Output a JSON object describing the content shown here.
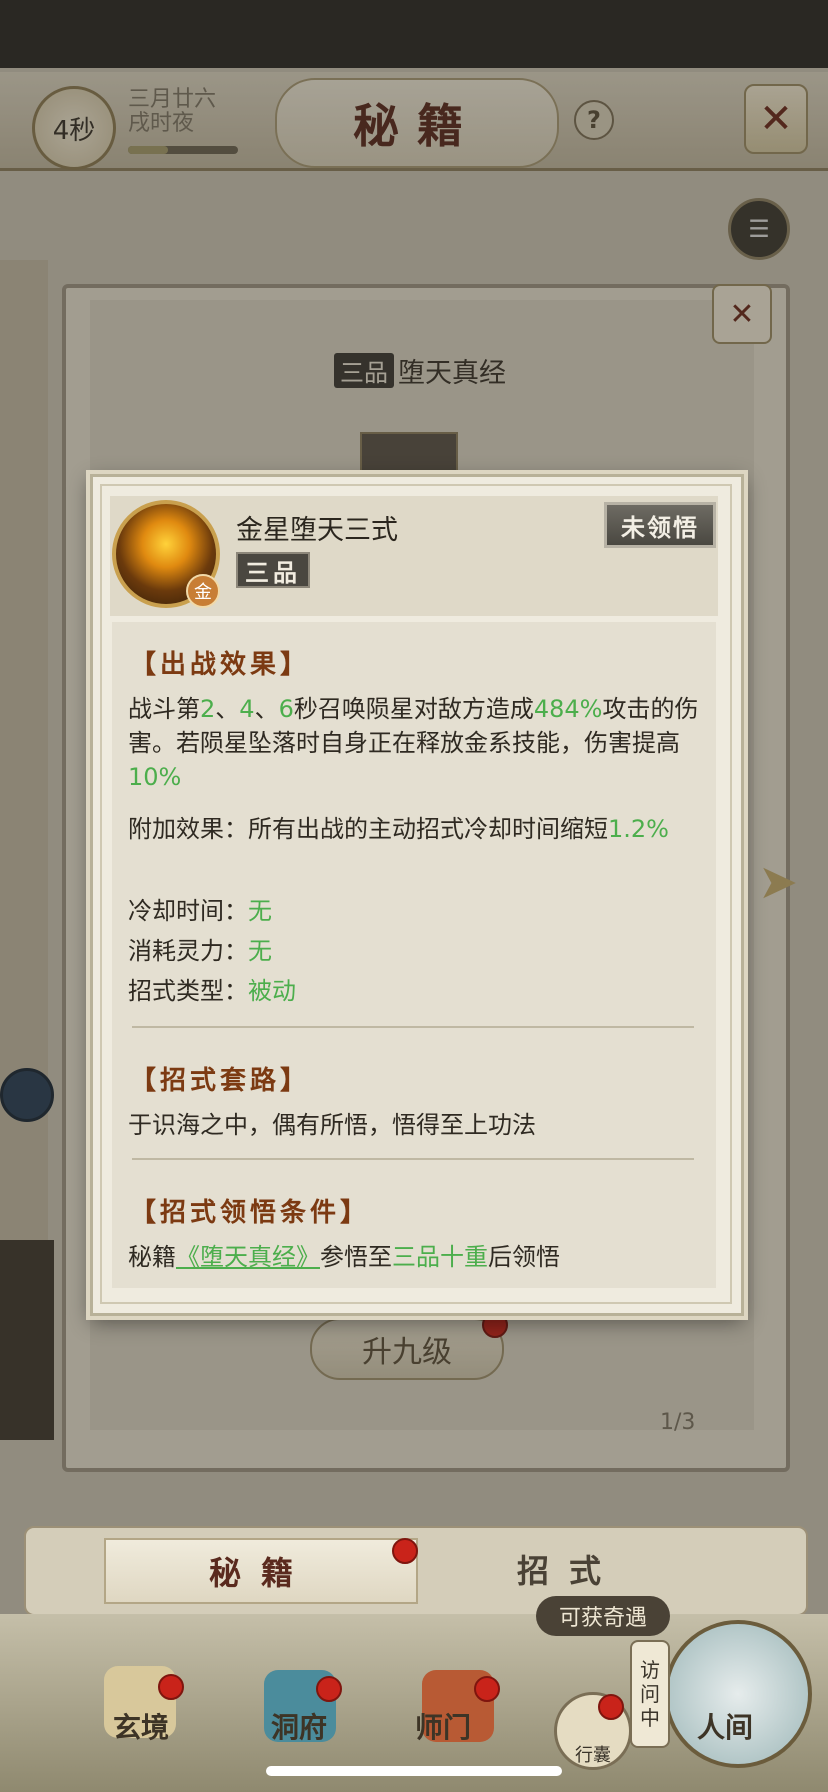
{
  "header": {
    "timer": "4秒",
    "date_line1": "三月廿六",
    "date_line2": "戌时夜",
    "title": "秘籍",
    "help": "?"
  },
  "book": {
    "grade": "三品",
    "name": "堕天真经",
    "upgrade_button": "升九级",
    "page_indicator": "1/3"
  },
  "dialog": {
    "skill_name": "金星堕天三式",
    "grade": "三品",
    "element_badge": "金",
    "status": "未领悟",
    "sections": {
      "effect_title": "【出战效果】",
      "effect_parts": [
        "战斗第",
        "2",
        "、",
        "4",
        "、",
        "6",
        "秒召唤陨星对敌方造成",
        "484%",
        "攻击的伤害。若陨星坠落时自身正在释放金系技能，伤害提高",
        "10%"
      ],
      "extra_prefix": "附加效果：所有出战的主动招式冷却时间缩短",
      "extra_value": "1.2%",
      "cooldown_label": "冷却时间：",
      "cooldown_value": "无",
      "cost_label": "消耗灵力：",
      "cost_value": "无",
      "type_label": "招式类型：",
      "type_value": "被动",
      "routine_title": "【招式套路】",
      "routine_text": "于识海之中，偶有所悟，悟得至上功法",
      "condition_title": "【招式领悟条件】",
      "condition_prefix": "秘籍",
      "condition_book": "《堕天真经》",
      "condition_mid": "参悟至",
      "condition_level": "三品十重",
      "condition_suffix": "后领悟"
    }
  },
  "tabs": [
    "秘籍",
    "招式"
  ],
  "bottom_nav": {
    "chance_tag": "可获奇遇",
    "visit_tag": [
      "访",
      "问",
      "中"
    ],
    "bag": "行囊",
    "items": [
      "玄境",
      "洞府",
      "师门",
      "人间"
    ]
  },
  "colors": {
    "highlight": "#4cae4c",
    "section_title": "#7c3a12",
    "title_text": "#5a2a1e"
  }
}
